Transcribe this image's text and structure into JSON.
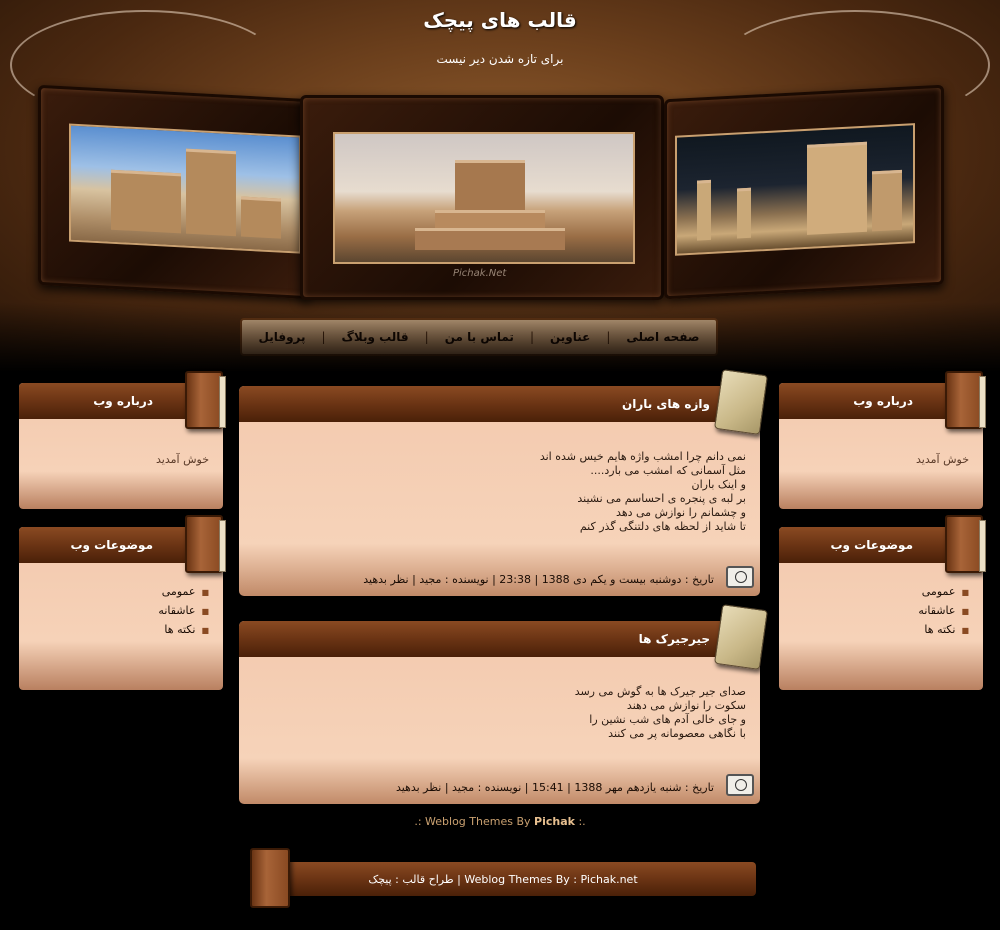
{
  "header": {
    "title": "قالب های پیچک",
    "description": "برای تازه شدن دیر نیست",
    "watermark": "Pichak.Net"
  },
  "nav": {
    "items": [
      "صفحه اصلی",
      "عناوین",
      "تماس با من",
      "قالب وبلاگ",
      "پروفایل"
    ],
    "separator": "|"
  },
  "sidebar_right": {
    "about": {
      "title": "درباره وب",
      "text": "خوش آمدید"
    },
    "topics": {
      "title": "موضوعات وب",
      "items": [
        "عمومی",
        "عاشقانه",
        "نکته ها"
      ]
    }
  },
  "sidebar_left": {
    "about": {
      "title": "درباره وب",
      "text": "خوش آمدید"
    },
    "topics": {
      "title": "موضوعات وب",
      "items": [
        "عمومی",
        "عاشقانه",
        "نکته ها"
      ]
    }
  },
  "posts": [
    {
      "title": "وازه های باران",
      "lines": [
        "نمی دانم چرا امشب واژه هایم خیس شده اند",
        "مثل آسمانی که امشب می بارد....",
        "و اینک باران",
        "بر لبه ی پنجره ی احساسم می نشیند",
        "و چشمانم را نوازش می دهد",
        "تا شاید از لحظه های دلتنگی گذر کنم"
      ],
      "meta": "تاریخ : دوشنبه بیست و یکم دی 1388 | 23:38 | نویسنده : مجید | نظر بدهید"
    },
    {
      "title": "جیرجیرک ها",
      "lines": [
        "صدای جیر جیرک ها به گوش می رسد",
        "سکوت را نوازش می دهند",
        "و جای خالی آدم های شب نشین را",
        "با نگاهی معصومانه پر می کنند"
      ],
      "meta": "تاریخ : شنبه یازدهم مهر 1388 | 15:41 | نویسنده : مجید | نظر بدهید"
    }
  ],
  "credit": {
    "prefix": ".: Weblog Themes By ",
    "brand": "Pichak",
    "suffix": " :."
  },
  "footer": {
    "text": "طراح قالب : پیچک | Weblog Themes By : Pichak.net"
  }
}
